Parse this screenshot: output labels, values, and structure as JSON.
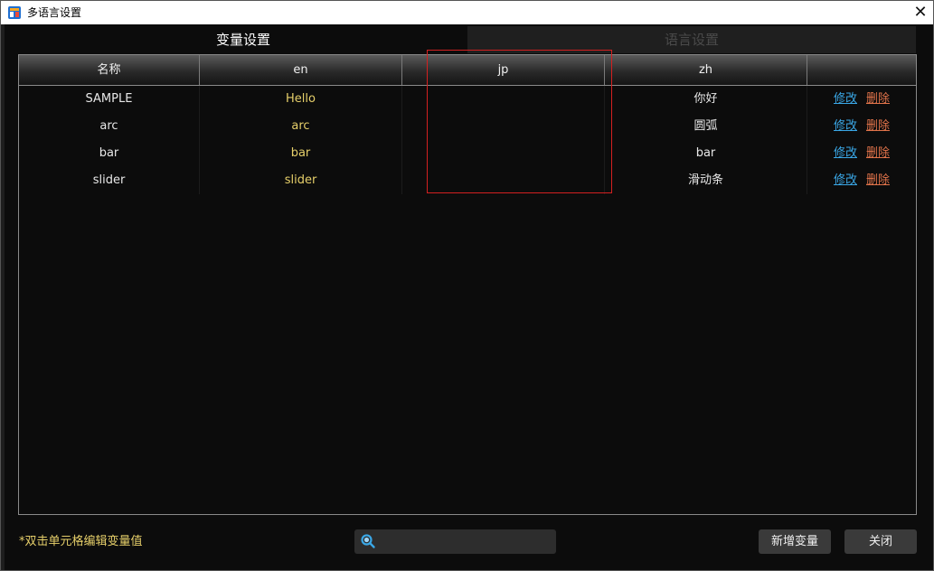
{
  "window": {
    "title": "多语言设置",
    "close_glyph": "✕"
  },
  "tabs": [
    {
      "label": "变量设置",
      "active": true
    },
    {
      "label": "语言设置",
      "active": false
    }
  ],
  "table": {
    "headers": [
      "名称",
      "en",
      "jp",
      "zh",
      ""
    ],
    "rows": [
      {
        "name": "SAMPLE",
        "en": "Hello",
        "jp": "",
        "zh": "你好",
        "edit": "修改",
        "delete": "删除"
      },
      {
        "name": "arc",
        "en": "arc",
        "jp": "",
        "zh": "圆弧",
        "edit": "修改",
        "delete": "删除"
      },
      {
        "name": "bar",
        "en": "bar",
        "jp": "",
        "zh": "bar",
        "edit": "修改",
        "delete": "删除"
      },
      {
        "name": "slider",
        "en": "slider",
        "jp": "",
        "zh": "滑动条",
        "edit": "修改",
        "delete": "删除"
      }
    ]
  },
  "footer": {
    "hint": "*双击单元格编辑变量值",
    "search_value": "",
    "add_label": "新增变量",
    "close_label": "关闭"
  },
  "colors": {
    "accent_link": "#3aa7e6",
    "delete_link": "#e0734a",
    "en_text": "#e6cf6a",
    "highlight": "#d32020"
  },
  "icons": {
    "app": "app-logo-icon",
    "close": "close-icon",
    "search": "search-icon"
  }
}
